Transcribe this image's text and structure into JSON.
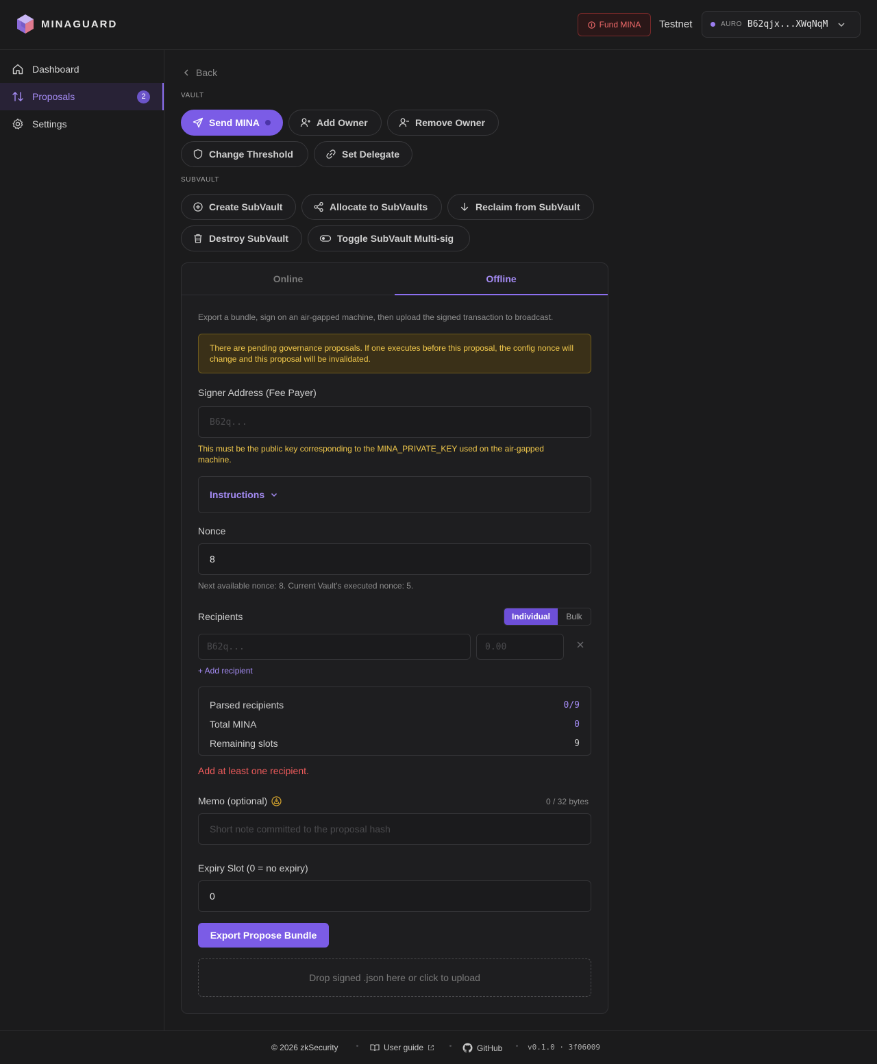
{
  "header": {
    "brand": "MINAGUARD",
    "fund_label": "Fund MINA",
    "network": "Testnet",
    "wallet_tag": "AURO",
    "wallet_address": "B62qjx...XWqNqM"
  },
  "sidebar": {
    "items": [
      {
        "label": "Dashboard"
      },
      {
        "label": "Proposals",
        "badge": "2"
      },
      {
        "label": "Settings"
      }
    ]
  },
  "main": {
    "back_label": "Back",
    "vault_label": "VAULT",
    "vault_actions": [
      "Send MINA",
      "Add Owner",
      "Remove Owner",
      "Change Threshold",
      "Set Delegate"
    ],
    "subvault_label": "SUBVAULT",
    "subvault_actions": [
      "Create SubVault",
      "Allocate to SubVaults",
      "Reclaim from SubVault",
      "Destroy SubVault",
      "Toggle SubVault Multi-sig"
    ]
  },
  "panel": {
    "tabs": [
      "Online",
      "Offline"
    ],
    "description": "Export a bundle, sign on an air-gapped machine, then upload the signed transaction to broadcast.",
    "warning": "There are pending governance proposals. If one executes before this proposal, the config nonce will change and this proposal will be invalidated.",
    "signer_label": "Signer Address (Fee Payer)",
    "signer_placeholder": "B62q...",
    "signer_hint": "This must be the public key corresponding to the MINA_PRIVATE_KEY used on the air-gapped machine.",
    "instructions_label": "Instructions",
    "nonce_label": "Nonce",
    "nonce_value": "8",
    "nonce_hint": "Next available nonce: 8. Current Vault's executed nonce: 5.",
    "recipients_label": "Recipients",
    "mode_options": [
      "Individual",
      "Bulk"
    ],
    "recipient_address_placeholder": "B62q...",
    "recipient_amount_placeholder": "0.00",
    "add_recipient_label": "+ Add recipient",
    "summary": [
      {
        "label": "Parsed recipients",
        "value": "0/9"
      },
      {
        "label": "Total MINA",
        "value": "0"
      },
      {
        "label": "Remaining slots",
        "value": "9"
      }
    ],
    "error": "Add at least one recipient.",
    "memo_label": "Memo (optional)",
    "memo_counter": "0 / 32 bytes",
    "memo_placeholder": "Short note committed to the proposal hash",
    "expiry_label": "Expiry Slot (0 = no expiry)",
    "expiry_value": "0",
    "export_label": "Export Propose Bundle",
    "drop_label": "Drop signed .json here or click to upload"
  },
  "footer": {
    "copyright": "© 2026 zkSecurity",
    "guide": "User guide",
    "github": "GitHub",
    "version": "v0.1.0 · 3f06009"
  },
  "colors": {
    "accent": "#7b5ce6",
    "warning": "#f2c94c",
    "error": "#ef5b5b",
    "fund": "#f06a6a"
  }
}
